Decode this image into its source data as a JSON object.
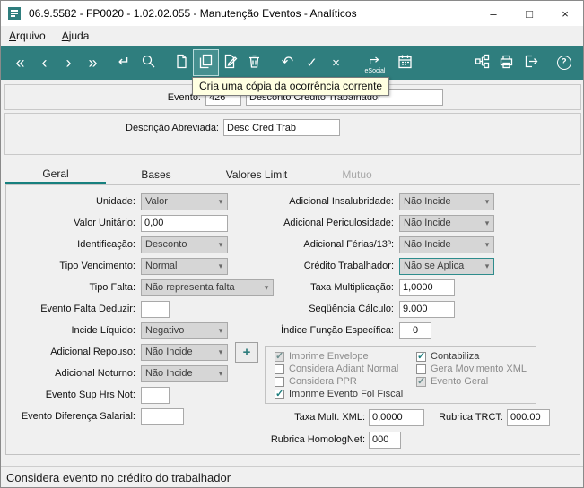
{
  "window": {
    "title": "06.9.5582 - FP0020 - 1.02.02.055 - Manutenção Eventos - Analíticos"
  },
  "icons": {
    "minimize": "–",
    "maximize": "□",
    "close": "×",
    "first": "«",
    "prev": "‹",
    "next": "›",
    "last": "»",
    "enter": "↵",
    "undo": "↶",
    "confirm": "✓",
    "cancel": "×",
    "help": "?",
    "dropdown": "▾",
    "plus": "+"
  },
  "menubar": {
    "items": [
      {
        "accel": "A",
        "rest": "rquivo"
      },
      {
        "accel": "A",
        "rest": "juda"
      }
    ]
  },
  "toolbar": {
    "esocial_label": "eSocial",
    "tooltip": "Cria uma cópia da ocorrência corrente"
  },
  "header": {
    "evento_label": "Evento:",
    "evento_code": "426",
    "evento_name": "Desconto Credito Trabalhador",
    "descricao_label": "Descrição Abreviada:",
    "descricao_value": "Desc Cred Trab"
  },
  "tabs": [
    {
      "label": "Geral"
    },
    {
      "label": "Bases"
    },
    {
      "label": "Valores Limit"
    },
    {
      "label": "Mutuo"
    }
  ],
  "fields": {
    "unidade": {
      "label": "Unidade:",
      "value": "Valor"
    },
    "valor_unitario": {
      "label": "Valor Unitário:",
      "value": "0,00"
    },
    "identificacao": {
      "label": "Identificação:",
      "value": "Desconto"
    },
    "tipo_vencimento": {
      "label": "Tipo Vencimento:",
      "value": "Normal"
    },
    "tipo_falta": {
      "label": "Tipo Falta:",
      "value": "Não representa falta"
    },
    "evento_falta_deduzir": {
      "label": "Evento Falta Deduzir:",
      "value": ""
    },
    "incide_liquido": {
      "label": "Incide Líquido:",
      "value": "Negativo"
    },
    "adicional_repouso": {
      "label": "Adicional Repouso:",
      "value": "Não Incide"
    },
    "adicional_noturno": {
      "label": "Adicional Noturno:",
      "value": "Não Incide"
    },
    "evento_sup_hrs_not": {
      "label": "Evento Sup Hrs Not:",
      "value": ""
    },
    "evento_diferenca_salarial": {
      "label": "Evento Diferença Salarial:",
      "value": ""
    },
    "adicional_insalubridade": {
      "label": "Adicional Insalubridade:",
      "value": "Não Incide"
    },
    "adicional_periculosidade": {
      "label": "Adicional Periculosidade:",
      "value": "Não Incide"
    },
    "adicional_ferias_13": {
      "label": "Adicional Férias/13º:",
      "value": "Não Incide"
    },
    "credito_trabalhador": {
      "label": "Crédito Trabalhador:",
      "value": "Não se Aplica"
    },
    "taxa_multiplicacao": {
      "label": "Taxa Multiplicação:",
      "value": "1,0000"
    },
    "sequencia_calculo": {
      "label": "Seqüência Cálculo:",
      "value": "9.000"
    },
    "indice_funcao_especifica": {
      "label": "Índice Função Específica:",
      "value": "0"
    },
    "taxa_mult_xml": {
      "label": "Taxa Mult. XML:",
      "value": "0,0000"
    },
    "rubrica_trct": {
      "label": "Rubrica TRCT:",
      "value": "000.00"
    },
    "rubrica_homolognet": {
      "label": "Rubrica HomologNet:",
      "value": "000"
    }
  },
  "checkboxes": {
    "imprime_envelope": {
      "label": "Imprime Envelope",
      "checked": true
    },
    "considera_adiant_normal": {
      "label": "Considera Adiant Normal",
      "checked": false
    },
    "considera_ppr": {
      "label": "Considera PPR",
      "checked": false
    },
    "imprime_evento_fol_fiscal": {
      "label": "Imprime Evento Fol Fiscal",
      "checked": true
    },
    "contabiliza": {
      "label": "Contabiliza",
      "checked": true
    },
    "gera_movimento_xml": {
      "label": "Gera Movimento XML",
      "checked": false
    },
    "evento_geral": {
      "label": "Evento Geral",
      "checked": true
    }
  },
  "statusbar": {
    "text": "Considera evento no crédito do trabalhador"
  }
}
